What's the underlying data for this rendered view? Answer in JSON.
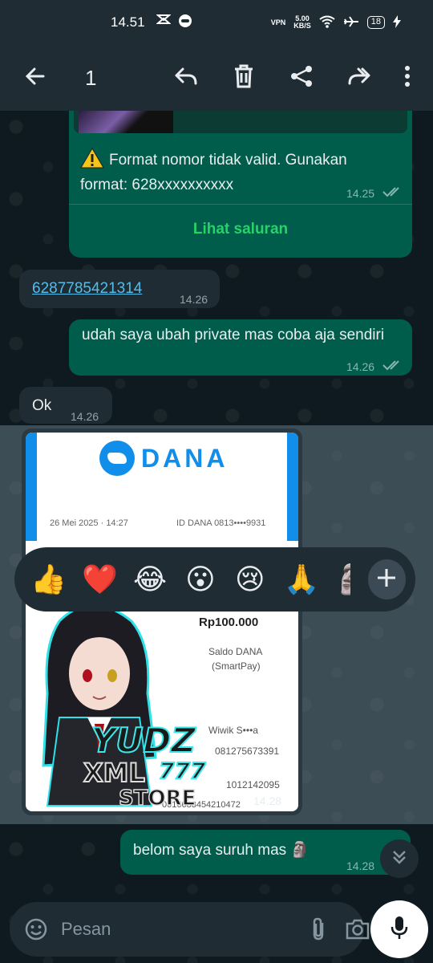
{
  "status_bar": {
    "time": "14.51",
    "net_speed_value": "5.00",
    "net_speed_unit": "KB/S",
    "vpn_label": "VPN",
    "battery": "18"
  },
  "app_bar": {
    "selected_count": "1",
    "icons": [
      "back-arrow-icon",
      "reply-icon",
      "delete-icon",
      "share-icon",
      "forward-icon",
      "more-vert-icon"
    ]
  },
  "messages": {
    "channel_card": {
      "warning_text": "Format nomor tidak valid. Gunakan format: 628xxxxxxxxxx",
      "time": "14.25",
      "link_label": "Lihat saluran"
    },
    "incoming_phone": {
      "text": "6287785421314",
      "time": "14.26"
    },
    "outgoing_1": {
      "text": "udah saya ubah private mas coba aja sendiri",
      "time": "14.26"
    },
    "incoming_ok": {
      "text": "Ok",
      "time": "14.26"
    },
    "image_message": {
      "time": "14.28",
      "receipt": {
        "brand": "DANA",
        "date": "26 Mei 2025 · 14:27",
        "id_label": "ID DANA 0813••••9931",
        "amount": "Rp100.000",
        "method_line1": "Saldo DANA",
        "method_line2": "(SmartPay)",
        "recipient": "Wiwik S•••a",
        "recipient_phone": "081275673391",
        "ref": "1012142095",
        "ref2": "0016683454210472"
      },
      "sticker_text_1": "YUDZ",
      "sticker_text_2": "XML",
      "sticker_text_3": "777",
      "sticker_text_4": "STORE"
    },
    "outgoing_2": {
      "text": "belom saya suruh mas 🗿",
      "time": "14.28"
    }
  },
  "reactions": {
    "emojis": [
      "👍",
      "❤️",
      "😂",
      "😮",
      "😢",
      "🙏"
    ],
    "partial_emoji": "🗿"
  },
  "composer": {
    "placeholder": "Pesan",
    "icons": [
      "emoji-icon",
      "attach-icon",
      "camera-icon",
      "mic-icon"
    ]
  },
  "colors": {
    "outgoing_bubble": "#005c4b",
    "incoming_bubble": "#1f2c34",
    "accent_green": "#25d366",
    "link_blue": "#53bdeb",
    "dana_blue": "#118ee9"
  }
}
